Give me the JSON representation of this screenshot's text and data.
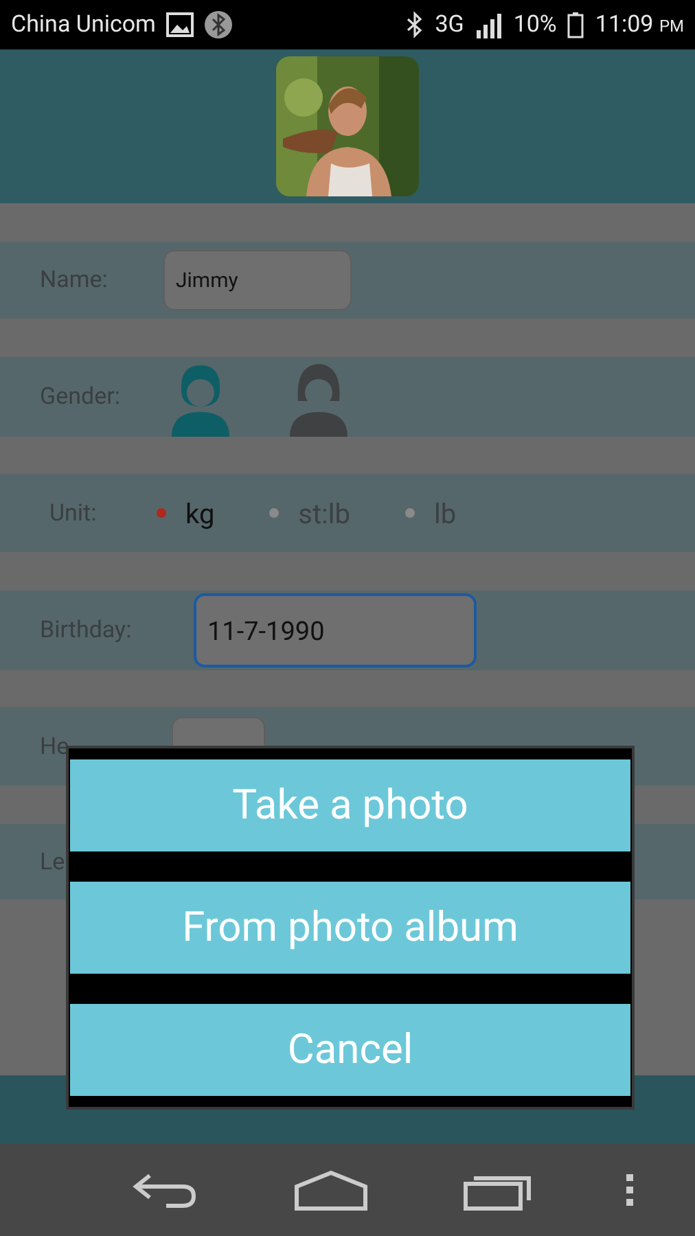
{
  "status_bar": {
    "carrier": "China Unicom",
    "network": "3G",
    "battery": "10%",
    "time": "11:09",
    "meridiem": "PM"
  },
  "form": {
    "name": {
      "label": "Name:",
      "value": "Jimmy"
    },
    "gender": {
      "label": "Gender:",
      "options": [
        {
          "kind": "male",
          "selected": true
        },
        {
          "kind": "female",
          "selected": false
        }
      ]
    },
    "unit": {
      "label": "Unit:",
      "options": [
        {
          "label": "kg",
          "selected": true
        },
        {
          "label": "st:lb",
          "selected": false
        },
        {
          "label": "lb",
          "selected": false
        }
      ]
    },
    "birthday": {
      "label": "Birthday:",
      "value": "11-7-1990",
      "focused": true
    },
    "height": {
      "label": "He"
    },
    "row_6": {
      "label": "Le"
    }
  },
  "dialog": {
    "options": [
      "Take a photo",
      "From photo album",
      "Cancel"
    ]
  }
}
